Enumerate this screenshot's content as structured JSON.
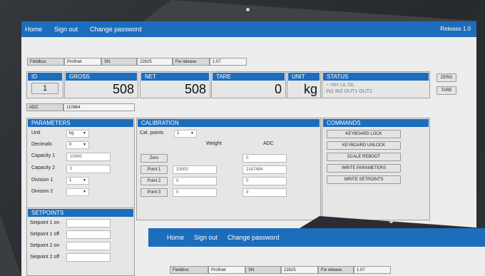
{
  "nav": {
    "home": "Home",
    "signout": "Sign out",
    "change_password": "Change password",
    "release": "Release 1.0"
  },
  "info": {
    "fieldbus_label": "Fieldbus",
    "fieldbus_value": "Profinet",
    "sn_label": "SN",
    "sn_value": "22625",
    "fw_label": "Fw release",
    "fw_value": "1.07"
  },
  "weights": {
    "id_label": "ID",
    "id_value": "1",
    "gross_label": "GROSS",
    "gross_value": "508",
    "net_label": "NET",
    "net_value": "508",
    "tare_label": "TARE",
    "tare_value": "0",
    "unit_label": "UNIT",
    "unit_value": "kg",
    "status_label": "STATUS",
    "status_line1": "~   >0<   UL     OL",
    "status_line2": "IN1 IN2 OUT1 OUT2",
    "zero_button": "ZERO",
    "tare_button": "TARE"
  },
  "adc": {
    "label": "ADC",
    "value": "110664"
  },
  "parameters": {
    "title": "PARAMETERS",
    "unit_label": "Unit",
    "unit_value": "kg",
    "decimals_label": "Decimals",
    "decimals_value": "0",
    "cap1_label": "Capacity 1",
    "cap1_value": "10000",
    "cap2_label": "Capacity 2",
    "cap2_value": "0",
    "div1_label": "Division 1",
    "div1_value": "1",
    "div2_label": "Division 2",
    "div2_value": ""
  },
  "calibration": {
    "title": "CALIBRATION",
    "cal_points_label": "Cal. points",
    "cal_points_value": "1",
    "weight_header": "Weight",
    "adc_header": "ADC",
    "zero_button": "Zero",
    "zero_adc": "0",
    "point1_button": "Point 1",
    "point1_weight": "10000",
    "point1_adc": "2147484",
    "point2_button": "Point 2",
    "point2_weight": "0",
    "point2_adc": "0",
    "point3_button": "Point 3",
    "point3_weight": "0",
    "point3_adc": "0"
  },
  "commands": {
    "title": "COMMANDS",
    "keyboard_lock": "KEYBOARD LOCK",
    "keyboard_unlock": "KEYBOARD UNLOCK",
    "scale_reboot": "SCALE REBOOT",
    "write_parameters": "WRITE PARAMETERS",
    "write_setpoints": "WRITE SETPOINTS"
  },
  "setpoints": {
    "title": "SETPOINTS",
    "sp1_on": "Setpoint 1 on",
    "sp1_off": "Setpoint 1 off",
    "sp2_on": "Setpoint 2 on",
    "sp2_off": "Setpoint 2 off"
  },
  "colors": {
    "accent": "#1d6dbd",
    "background": "#2a2d31",
    "panel": "#e6e6e6"
  }
}
